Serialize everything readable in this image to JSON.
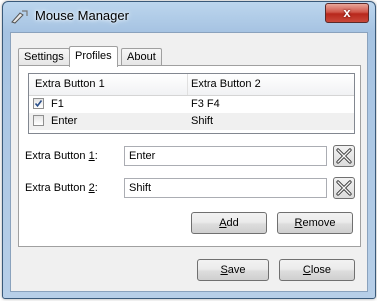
{
  "window": {
    "title": "Mouse Manager",
    "close_glyph": "x"
  },
  "tabs": [
    {
      "label": "Settings",
      "active": false
    },
    {
      "label": "Profiles",
      "active": true
    },
    {
      "label": "About",
      "active": false
    }
  ],
  "list": {
    "columns": [
      "Extra Button 1",
      "Extra Button 2"
    ],
    "rows": [
      {
        "checked": true,
        "button1": "F1",
        "button2": "F3 F4"
      },
      {
        "checked": false,
        "button1": "Enter",
        "button2": "Shift"
      }
    ]
  },
  "fields": {
    "button1": {
      "label_pre": "Extra Button ",
      "label_key": "1",
      "label_post": ":",
      "value": "Enter"
    },
    "button2": {
      "label_pre": "Extra Button ",
      "label_key": "2",
      "label_post": ":",
      "value": "Shift"
    }
  },
  "buttons": {
    "add": {
      "key": "A",
      "rest": "dd"
    },
    "remove": {
      "key": "R",
      "rest": "emove"
    },
    "save": {
      "key": "S",
      "rest": "ave"
    },
    "close": {
      "key": "C",
      "rest": "lose"
    }
  },
  "icons": {
    "app": "mouse-pointer-icon",
    "clear": "clear-x-icon"
  }
}
